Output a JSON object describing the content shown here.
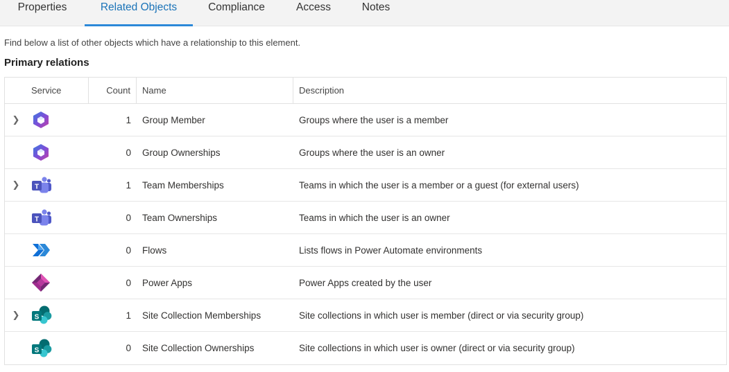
{
  "tabs": [
    {
      "label": "Properties"
    },
    {
      "label": "Related Objects"
    },
    {
      "label": "Compliance"
    },
    {
      "label": "Access"
    },
    {
      "label": "Notes"
    }
  ],
  "intro": "Find below a list of other objects which have a relationship to this element.",
  "section_title": "Primary relations",
  "columns": {
    "service": "Service",
    "count": "Count",
    "name": "Name",
    "description": "Description"
  },
  "rows": [
    {
      "icon": "office-groups-icon",
      "expandable": true,
      "count": "1",
      "name": "Group Member",
      "description": "Groups where the user is a member"
    },
    {
      "icon": "office-groups-icon",
      "expandable": false,
      "count": "0",
      "name": "Group Ownerships",
      "description": "Groups where the user is an owner"
    },
    {
      "icon": "teams-icon",
      "expandable": true,
      "count": "1",
      "name": "Team Memberships",
      "description": "Teams in which the user is a member or a guest (for external users)"
    },
    {
      "icon": "teams-icon",
      "expandable": false,
      "count": "0",
      "name": "Team Ownerships",
      "description": "Teams in which the user is an owner"
    },
    {
      "icon": "power-automate-icon",
      "expandable": false,
      "count": "0",
      "name": "Flows",
      "description": "Lists flows in Power Automate environments"
    },
    {
      "icon": "power-apps-icon",
      "expandable": false,
      "count": "0",
      "name": "Power Apps",
      "description": "Power Apps created by the user"
    },
    {
      "icon": "sharepoint-icon",
      "expandable": true,
      "count": "1",
      "name": "Site Collection Memberships",
      "description": "Site collections in which user is member (direct or via security group)"
    },
    {
      "icon": "sharepoint-icon",
      "expandable": false,
      "count": "0",
      "name": "Site Collection Ownerships",
      "description": "Site collections in which user is owner (direct or via security group)"
    }
  ],
  "icon_letters": {
    "teams": "T",
    "sharepoint": "S"
  },
  "colors": {
    "active_tab": "#1a73b8",
    "tab_underline": "#2b88d8"
  }
}
